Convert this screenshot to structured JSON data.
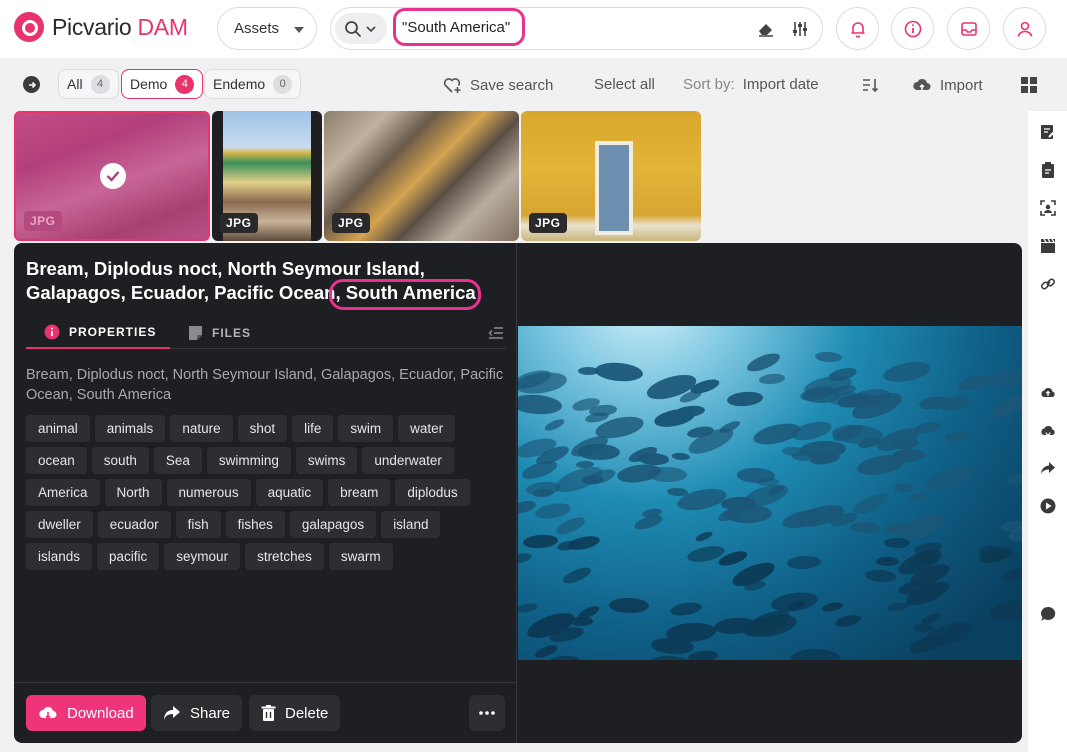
{
  "brand": {
    "name": "Picvario",
    "suffix": "DAM",
    "accent": "#e8336d"
  },
  "header": {
    "asset_type": "Assets",
    "search": {
      "value": "\"South America\""
    }
  },
  "toolbar": {
    "filters": [
      {
        "label": "All",
        "count": "4"
      },
      {
        "label": "Demo",
        "count": "4"
      },
      {
        "label": "Endemo",
        "count": "0"
      }
    ],
    "save_search": "Save search",
    "select_all": "Select all",
    "sort_label": "Sort by:",
    "sort_value": "Import date",
    "import": "Import"
  },
  "thumbnails": [
    {
      "format": "JPG",
      "selected": true
    },
    {
      "format": "JPG"
    },
    {
      "format": "JPG"
    },
    {
      "format": "JPG"
    }
  ],
  "detail": {
    "title_part1": "Bream, Diplodus noct, North Seymour Island, Galapagos, Ecuador, Pacific Ocean,",
    "title_part2": "South America",
    "tabs": {
      "properties": "PROPERTIES",
      "files": "FILES"
    },
    "description": "Bream, Diplodus noct, North Seymour Island, Galapagos, Ecuador, Pacific Ocean, South America",
    "tags": [
      "animal",
      "animals",
      "nature",
      "shot",
      "life",
      "swim",
      "water",
      "ocean",
      "south",
      "Sea",
      "swimming",
      "swims",
      "underwater",
      "America",
      "North",
      "numerous",
      "aquatic",
      "bream",
      "diplodus",
      "dweller",
      "ecuador",
      "fish",
      "fishes",
      "galapagos",
      "island",
      "islands",
      "pacific",
      "seymour",
      "stretches",
      "swarm"
    ],
    "actions": {
      "download": "Download",
      "share": "Share",
      "delete": "Delete"
    }
  }
}
